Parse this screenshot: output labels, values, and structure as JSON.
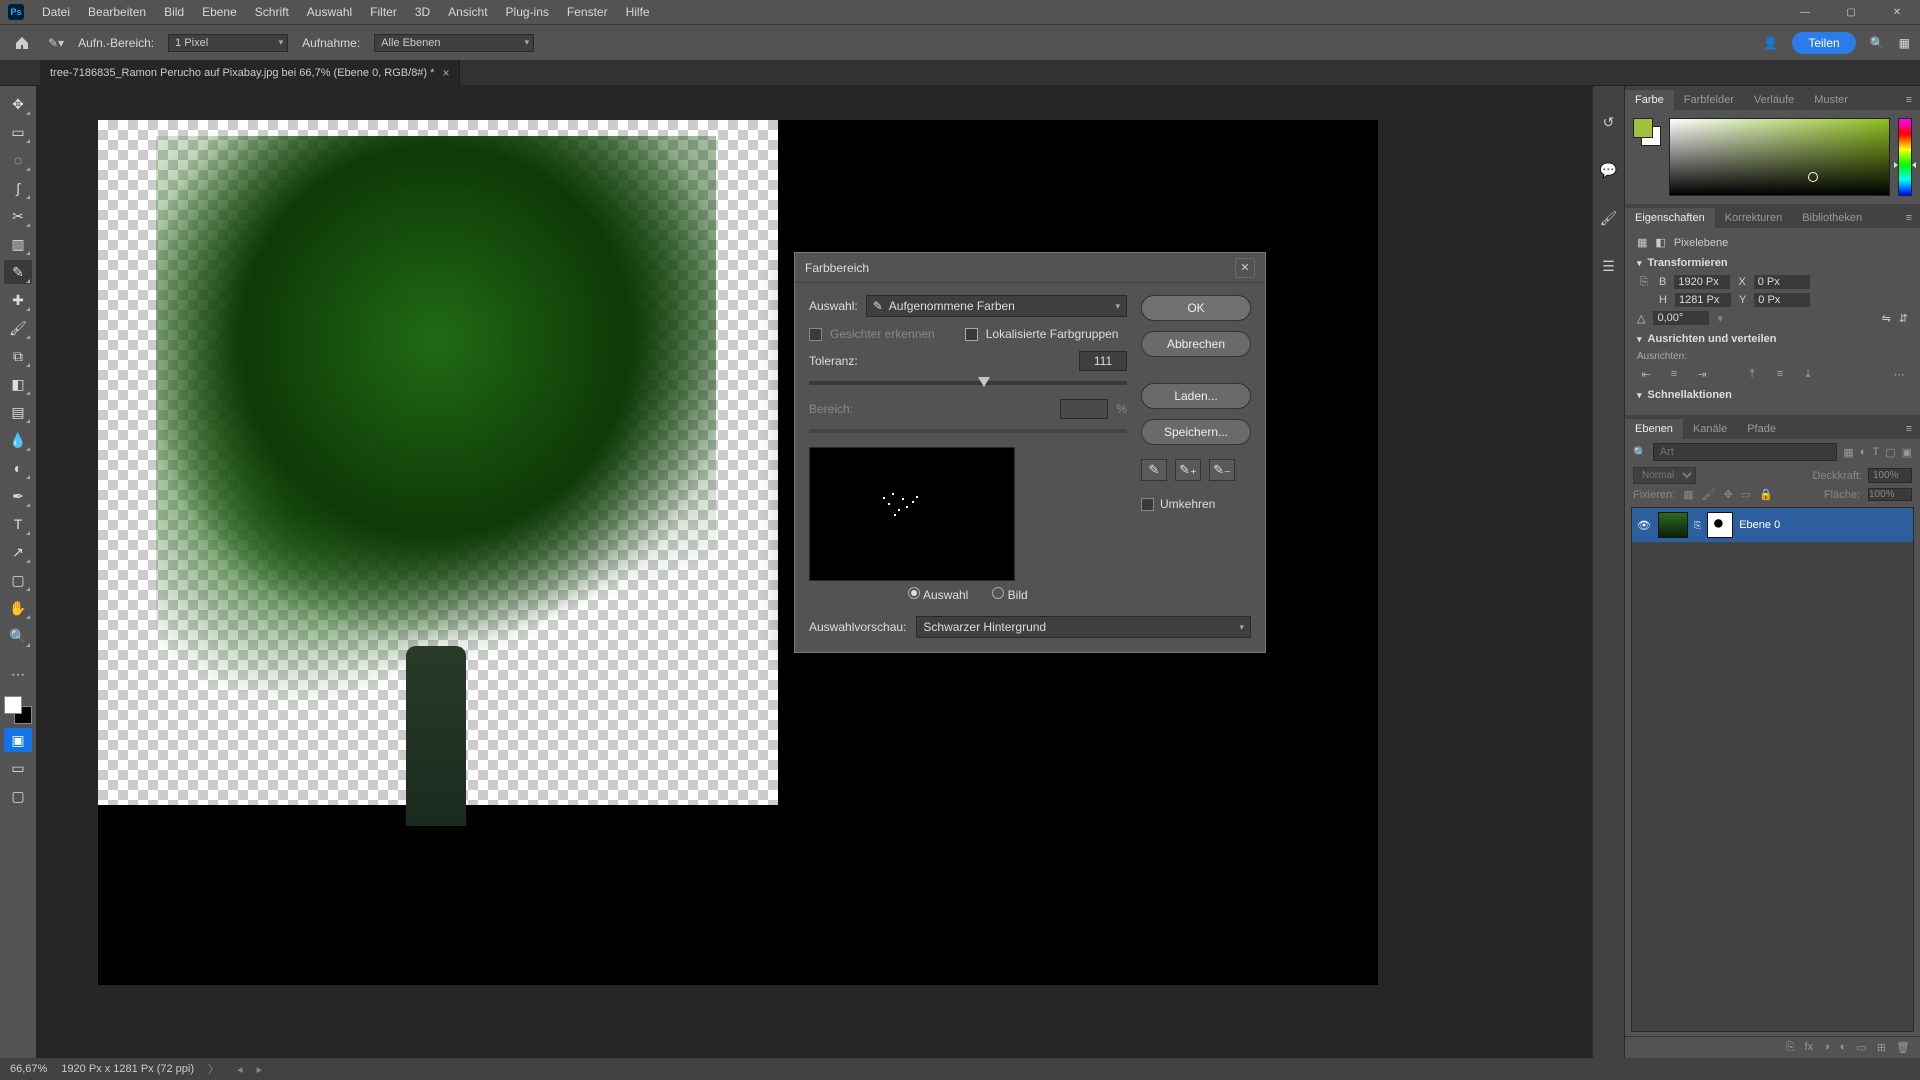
{
  "menubar": {
    "items": [
      "Datei",
      "Bearbeiten",
      "Bild",
      "Ebene",
      "Schrift",
      "Auswahl",
      "Filter",
      "3D",
      "Ansicht",
      "Plug-ins",
      "Fenster",
      "Hilfe"
    ]
  },
  "optionsbar": {
    "sample_label": "Aufn.-Bereich:",
    "sample_value": "1 Pixel",
    "sample2_label": "Aufnahme:",
    "sample2_value": "Alle Ebenen",
    "share_label": "Teilen"
  },
  "document_tab": {
    "title": "tree-7186835_Ramon Perucho auf Pixabay.jpg bei 66,7% (Ebene 0, RGB/8#) *"
  },
  "statusbar": {
    "zoom": "66,67%",
    "info": "1920 Px x 1281 Px (72 ppi)"
  },
  "color_panel": {
    "tabs": [
      "Farbe",
      "Farbfelder",
      "Verläufe",
      "Muster"
    ]
  },
  "properties_panel": {
    "tabs": [
      "Eigenschaften",
      "Korrekturen",
      "Bibliotheken"
    ],
    "layer_type": "Pixelebene",
    "transform_header": "Transformieren",
    "width_label": "B",
    "width_value": "1920 Px",
    "x_label": "X",
    "x_value": "0 Px",
    "height_label": "H",
    "height_value": "1281 Px",
    "y_label": "Y",
    "y_value": "0 Px",
    "angle_value": "0,00°",
    "align_header": "Ausrichten und verteilen",
    "align_label": "Ausrichten:",
    "quick_header": "Schnellaktionen"
  },
  "layers_panel": {
    "tabs": [
      "Ebenen",
      "Kanäle",
      "Pfade"
    ],
    "search_placeholder": "Art",
    "blend_mode": "Normal",
    "opacity_label": "Deckkraft:",
    "opacity_value": "100%",
    "lock_label": "Fixieren:",
    "fill_label": "Fläche:",
    "fill_value": "100%",
    "layer_name": "Ebene 0"
  },
  "dialog": {
    "title": "Farbbereich",
    "select_label": "Auswahl:",
    "select_value": "Aufgenommene Farben",
    "faces_label": "Gesichter erkennen",
    "localized_label": "Lokalisierte Farbgruppen",
    "tolerance_label": "Toleranz:",
    "tolerance_value": "111",
    "range_label": "Bereich:",
    "range_unit": "%",
    "radio_selection": "Auswahl",
    "radio_image": "Bild",
    "preview_select_label": "Auswahlvorschau:",
    "preview_select_value": "Schwarzer Hintergrund",
    "btn_ok": "OK",
    "btn_cancel": "Abbrechen",
    "btn_load": "Laden...",
    "btn_save": "Speichern...",
    "invert_label": "Umkehren"
  },
  "tool_names": [
    "move",
    "artboard",
    "marquee",
    "lasso",
    "crop",
    "frame",
    "eyedropper",
    "brush",
    "heal",
    "clone",
    "eraser",
    "gradient",
    "blur",
    "dodge",
    "pen",
    "type",
    "path",
    "rectangle",
    "hand",
    "zoom"
  ]
}
